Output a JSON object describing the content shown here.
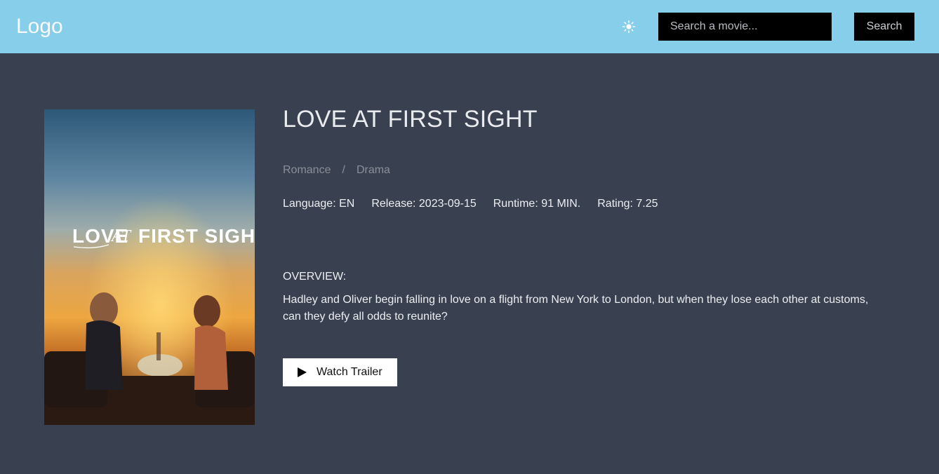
{
  "header": {
    "logo": "Logo",
    "theme_icon": "sun-icon",
    "search_placeholder": "Search a movie...",
    "search_label": "Search"
  },
  "movie": {
    "title": "LOVE AT FIRST SIGHT",
    "poster_title_parts": [
      "LOVE",
      "AT",
      "FIRST SIGHT"
    ],
    "genres": [
      "Romance",
      "Drama"
    ],
    "genre_separator": "/",
    "meta": {
      "language": "Language: EN",
      "release": "Release: 2023-09-15",
      "runtime": "Runtime: 91 MIN.",
      "rating": "Rating: 7.25"
    },
    "overview_label": "OVERVIEW:",
    "overview": "Hadley and Oliver begin falling in love on a flight from New York to London, but when they lose each other at customs, can they defy all odds to reunite?",
    "trailer_label": "Watch Trailer",
    "trailer_icon": "play-icon"
  },
  "colors": {
    "header_bg": "#87ceea",
    "page_bg": "#394150",
    "muted_text": "#8a8f97"
  }
}
